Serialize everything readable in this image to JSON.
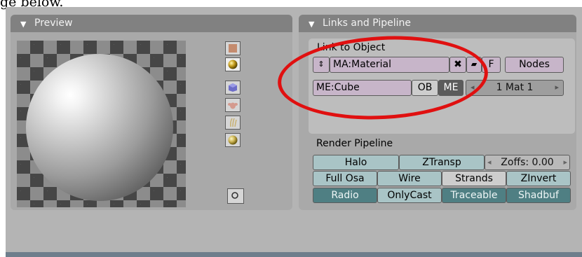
{
  "caption": "ge below.",
  "preview_panel": {
    "title": "Preview"
  },
  "links_panel": {
    "title": "Links and Pipeline",
    "link_label": "Link to Object",
    "material_field": "MA:Material",
    "close_glyph": "✖",
    "f_label": "F",
    "nodes_label": "Nodes",
    "mesh_field": "ME:Cube",
    "ob_label": "OB",
    "me_label": "ME",
    "mat_index": "1 Mat 1",
    "left_arrow": "◂",
    "right_arrow": "▸"
  },
  "render_pipeline": {
    "title": "Render Pipeline",
    "row1": {
      "halo": "Halo",
      "ztransp": "ZTransp",
      "zoffs": "Zoffs: 0.00"
    },
    "row2": {
      "full_osa": "Full Osa",
      "wire": "Wire",
      "strands": "Strands",
      "zinvert": "ZInvert"
    },
    "row3": {
      "radio": "Radio",
      "onlycast": "OnlyCast",
      "traceable": "Traceable",
      "shadbuf": "Shadbuf"
    }
  },
  "preview_buttons": [
    "flat-plane-icon",
    "sphere-icon",
    "cube-icon",
    "monkey-icon",
    "hair-icon",
    "sky-sphere-icon",
    "preview-circle-icon"
  ],
  "annotation_color": "#e01010"
}
